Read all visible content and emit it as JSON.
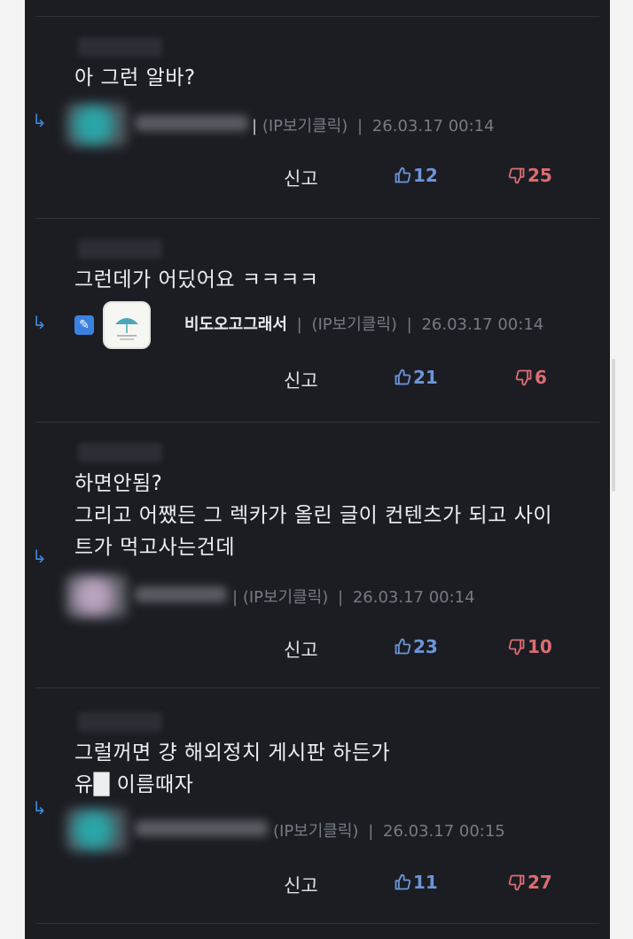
{
  "comments": [
    {
      "text_lines": [
        "아 그런 알바?"
      ],
      "ip_label": "(IP보기클릭)",
      "timestamp": "26.03.17 00:14",
      "report_label": "신고",
      "likes": "12",
      "dislikes": "25"
    },
    {
      "text_lines": [
        "그런데가 어딨어요 ㅋㅋㅋㅋ"
      ],
      "nickname": "비도오고그래서",
      "ip_label": "(IP보기클릭)",
      "timestamp": "26.03.17 00:14",
      "report_label": "신고",
      "likes": "21",
      "dislikes": "6"
    },
    {
      "text_lines": [
        "하면안됨?",
        "그리고 어쨌든 그 렉카가 올린 글이 컨텐츠가 되고 사이",
        "트가 먹고사는건데"
      ],
      "ip_label": "(IP보기클릭)",
      "timestamp": "26.03.17 00:14",
      "report_label": "신고",
      "likes": "23",
      "dislikes": "10"
    },
    {
      "text_lines": [
        "그럴꺼면 걍 해외정치 게시판 하든가",
        "유█ 이름때자"
      ],
      "ip_label": "(IP보기클릭)",
      "timestamp": "26.03.17 00:15",
      "report_label": "신고",
      "likes": "11",
      "dislikes": "27"
    }
  ],
  "colors": {
    "background": "#1b1d23",
    "text": "#eceef2",
    "meta": "#767a83",
    "like": "#6d95d8",
    "dislike": "#dc6d72",
    "reply_arrow": "#3d86d6"
  },
  "icons": {
    "reply": "reply-arrow-icon",
    "like": "thumbs-up-icon",
    "dislike": "thumbs-down-icon",
    "editor": "pencil-icon"
  }
}
